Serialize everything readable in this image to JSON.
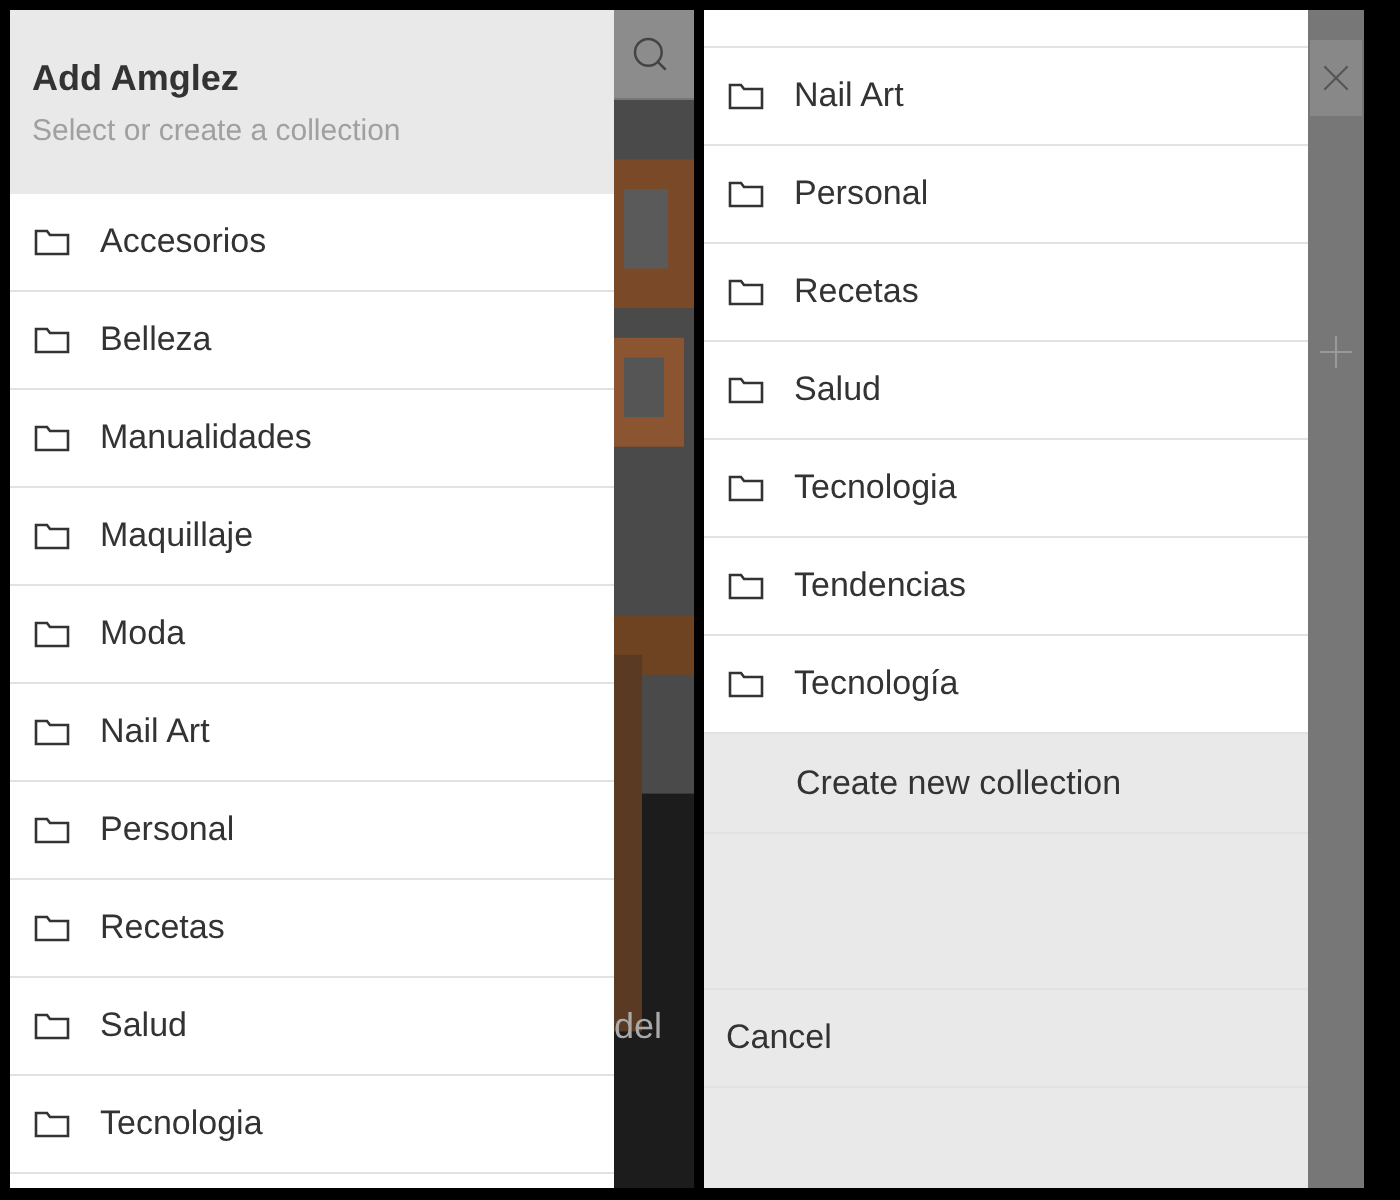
{
  "left_screen": {
    "header": {
      "title": "Add Amglez",
      "subtitle": "Select or create a collection"
    },
    "collections": [
      "Accesorios",
      "Belleza",
      "Manualidades",
      "Maquillaje",
      "Moda",
      "Nail Art",
      "Personal",
      "Recetas",
      "Salud",
      "Tecnologia"
    ],
    "background_text": "del"
  },
  "right_screen": {
    "collections": [
      "Nail Art",
      "Personal",
      "Recetas",
      "Salud",
      "Tecnologia",
      "Tendencias",
      "Tecnología"
    ],
    "create_button": "Create new collection",
    "cancel_button": "Cancel"
  }
}
